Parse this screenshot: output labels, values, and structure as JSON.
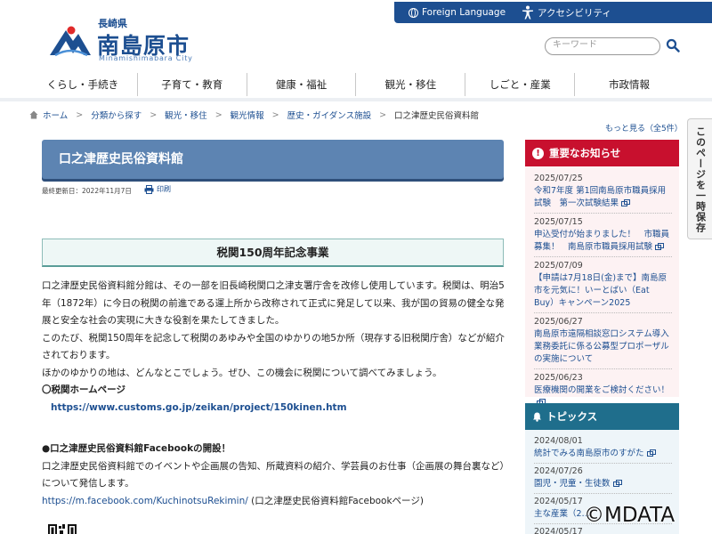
{
  "topbar": {
    "foreign_language": "Foreign Language",
    "accessibility": "アクセシビリティ"
  },
  "logo": {
    "prefecture": "長崎県",
    "city_name": "南島原市",
    "romaji": "Minamishimabara City"
  },
  "search": {
    "placeholder": "キーワード"
  },
  "nav": {
    "items": [
      "くらし・手続き",
      "子育て・教育",
      "健康・福祉",
      "観光・移住",
      "しごと・産業",
      "市政情報"
    ]
  },
  "breadcrumb": {
    "items": [
      "ホーム",
      "分類から探す",
      "観光・移住",
      "観光情報",
      "歴史・ガイダンス施設",
      "口之津歴史民俗資料館"
    ]
  },
  "side_tab": {
    "label": "このページを一時保存"
  },
  "main": {
    "title": "口之津歴史民俗資料館",
    "updated": "最終更新日：2022年11月7日",
    "print": "印刷",
    "section_title": "税関150周年記念事業",
    "para1": "口之津歴史民俗資料館分館は、その一部を旧長崎税関口之津支署庁舎を改修し使用しています。税関は、明治5年（1872年）に今日の税関の前進である運上所から改称されて正式に発足して以来、我が国の貿易の健全な発展と安全な社会の実現に大きな役割を果たしてきました。",
    "para2": "このたび、税関150周年を記念して税関のあゆみや全国のゆかりの地5か所（現存する旧税関庁舎）などが紹介されております。",
    "para3": "ほかのゆかりの地は、どんなとこでしょう。ぜひ、この機会に税関について調べてみましょう。",
    "customs_heading": "〇税関ホームページ",
    "customs_link": "https://www.customs.go.jp/zeikan/project/150kinen.htm",
    "facebook_heading": "●口之津歴史民俗資料館Facebookの開設！",
    "facebook_text": "口之津歴史民俗資料館でのイベントや企画展の告知、所蔵資料の紹介、学芸員のお仕事（企画展の舞台裏など）について発信します。",
    "facebook_link": "https://m.facebook.com/KuchinotsuRekimin/",
    "facebook_link_note": " (口之津歴史民俗資料館Facebookページ)"
  },
  "notice": {
    "more": "もっと見る（全5件）",
    "heading": "重要なお知らせ",
    "items": [
      {
        "date": "2025/07/25",
        "title": "令和7年度 第1回南島原市職員採用試験　第一次試験結果"
      },
      {
        "date": "2025/07/15",
        "title": "申込受付が始まりました！　市職員募集！　南島原市職員採用試験"
      },
      {
        "date": "2025/07/09",
        "title": "【申請は7月18日(金)まで】南島原市を元気に！いーとばい（Eat Buy）キャンペーン2025"
      },
      {
        "date": "2025/06/27",
        "title": "南島原市遠隔相談窓口システム導入業務委託に係る公募型プロポーザルの実施について"
      },
      {
        "date": "2025/06/23",
        "title": "医療機関の開業をご検討ください！"
      }
    ]
  },
  "topics": {
    "heading": "トピックス",
    "items": [
      {
        "date": "2024/08/01",
        "title": "統計でみる南島原市のすがた"
      },
      {
        "date": "2024/07/26",
        "title": "園児・児童・生徒数"
      },
      {
        "date": "2024/05/17",
        "title": "主な産業（2…"
      },
      {
        "date": "2024/05/17",
        "title": ""
      }
    ]
  },
  "watermark": "©MDATA",
  "colors": {
    "brand_blue": "#1d4f91",
    "title_bar": "#5d84b2",
    "notice_red": "#c8102e",
    "topics_teal": "#1f6e8c",
    "section_green": "#8dbcb8"
  }
}
